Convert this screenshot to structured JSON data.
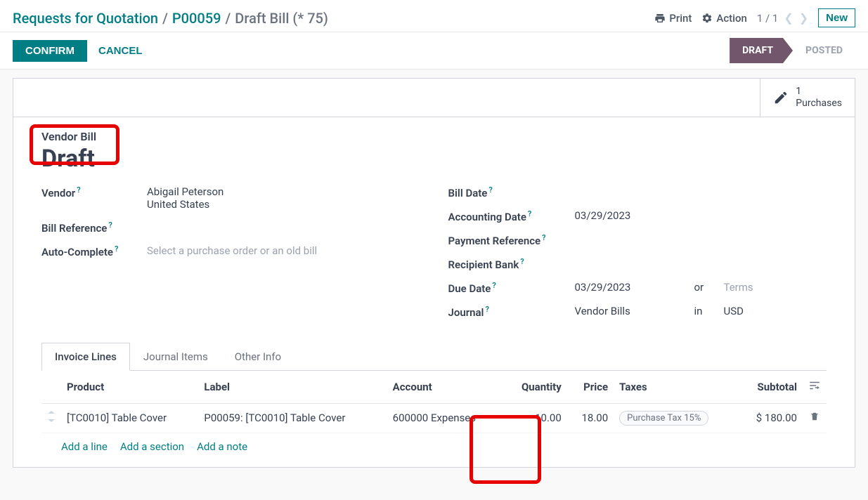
{
  "breadcrumb": {
    "part1": "Requests for Quotation",
    "part2": "P00059",
    "current": "Draft Bill (* 75)"
  },
  "topbar": {
    "print": "Print",
    "action": "Action",
    "pager": "1 / 1",
    "new_btn": "New"
  },
  "statusbar": {
    "confirm": "CONFIRM",
    "cancel": "CANCEL",
    "draft": "DRAFT",
    "posted": "POSTED"
  },
  "stat_button": {
    "count": "1",
    "label": "Purchases"
  },
  "doc": {
    "type_label": "Vendor Bill",
    "title": "Draft"
  },
  "labels": {
    "vendor": "Vendor",
    "bill_reference": "Bill Reference",
    "auto_complete": "Auto-Complete",
    "bill_date": "Bill Date",
    "accounting_date": "Accounting Date",
    "payment_reference": "Payment Reference",
    "recipient_bank": "Recipient Bank",
    "due_date": "Due Date",
    "journal": "Journal",
    "or": "or",
    "in": "in",
    "terms_placeholder": "Terms",
    "autocomplete_placeholder": "Select a purchase order or an old bill"
  },
  "values": {
    "vendor_name": "Abigail Peterson",
    "vendor_country": "United States",
    "accounting_date": "03/29/2023",
    "due_date": "03/29/2023",
    "journal": "Vendor Bills",
    "currency": "USD"
  },
  "tabs": {
    "invoice_lines": "Invoice Lines",
    "journal_items": "Journal Items",
    "other_info": "Other Info"
  },
  "table": {
    "headers": {
      "product": "Product",
      "label": "Label",
      "account": "Account",
      "quantity": "Quantity",
      "price": "Price",
      "taxes": "Taxes",
      "subtotal": "Subtotal"
    },
    "rows": [
      {
        "product": "[TC0010] Table Cover",
        "label": "P00059: [TC0010] Table Cover",
        "account": "600000 Expenses",
        "quantity": "10.00",
        "price": "18.00",
        "tax": "Purchase Tax 15%",
        "subtotal": "$ 180.00"
      }
    ],
    "add_line": "Add a line",
    "add_section": "Add a section",
    "add_note": "Add a note"
  }
}
